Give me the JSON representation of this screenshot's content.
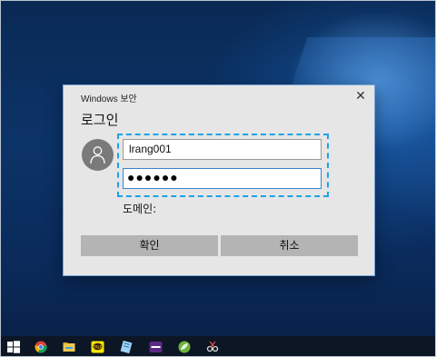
{
  "dialog": {
    "window_title": "Windows 보안",
    "heading": "로그인",
    "username_value": "lrang001",
    "password_value": "●●●●●●",
    "domain_label": "도메인:",
    "ok_label": "확인",
    "cancel_label": "취소"
  },
  "taskbar": {
    "icons": [
      "windows-start-icon",
      "chrome-icon",
      "file-explorer-icon",
      "kakaotalk-icon",
      "notepad-icon",
      "media-player-icon",
      "spring-tool-icon",
      "snipping-tool-icon"
    ]
  },
  "colors": {
    "dialog_bg": "#e6e6e6",
    "button_bg": "#b4b4b4",
    "highlight": "#1aa3e8"
  }
}
